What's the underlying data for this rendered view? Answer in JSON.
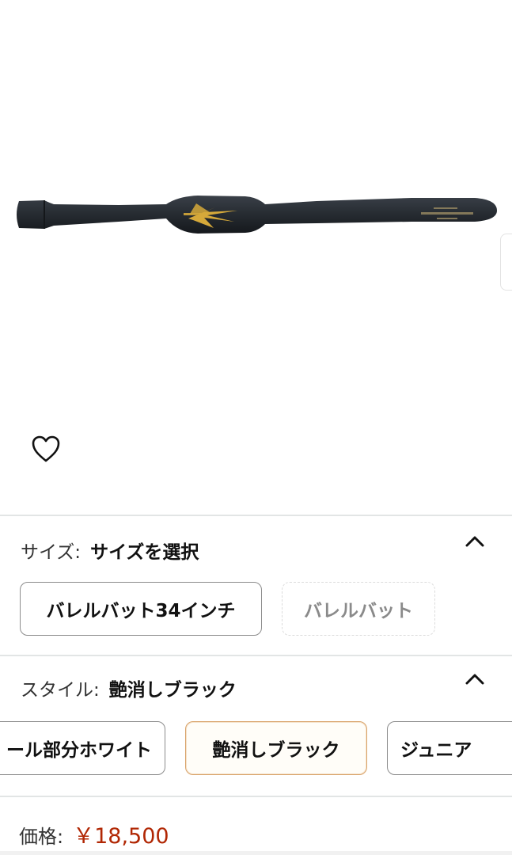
{
  "size": {
    "label": "サイズ:",
    "value": "サイズを選択",
    "options": [
      {
        "label": "バレルバット34インチ",
        "state": "available"
      },
      {
        "label": "バレルバット",
        "state": "unavailable"
      }
    ]
  },
  "style": {
    "label": "スタイル:",
    "value": "艶消しブラック",
    "options": [
      {
        "label": "ール部分ホワイト",
        "state": "available"
      },
      {
        "label": "艶消しブラック",
        "state": "selected"
      },
      {
        "label": "ジュニア",
        "state": "available"
      }
    ]
  },
  "price": {
    "label": "価格:",
    "value": "￥18,500"
  },
  "colors": {
    "price": "#b12704",
    "selected_border": "#d9a36a",
    "bat": "#2b3036",
    "logo": "#d6a93a"
  },
  "icons": [
    "heart-icon",
    "chevron-up-icon"
  ]
}
